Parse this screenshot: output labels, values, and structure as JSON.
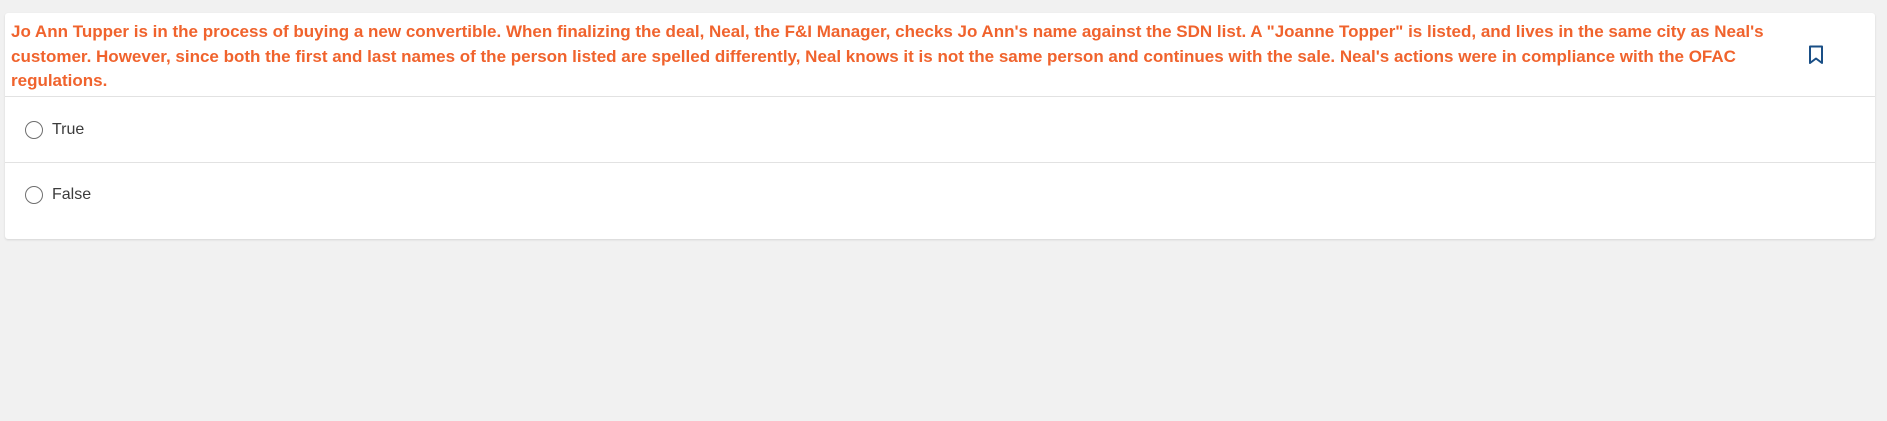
{
  "question": {
    "text": "Jo Ann Tupper is in the process of buying a new convertible. When finalizing the deal, Neal, the F&I Manager, checks Jo Ann's name against the SDN list. A \"Joanne Topper\" is listed, and lives in the same city as Neal's customer. However, since both the first and last names of the person listed are spelled differently, Neal knows it is not the same person and continues with the sale. Neal's actions were in compliance with the OFAC regulations.",
    "bookmark_icon": "bookmark-icon"
  },
  "options": [
    {
      "label": "True"
    },
    {
      "label": "False"
    }
  ],
  "colors": {
    "question_text": "#f0632d",
    "bookmark": "#1a4f86",
    "background": "#f1f1f1"
  }
}
